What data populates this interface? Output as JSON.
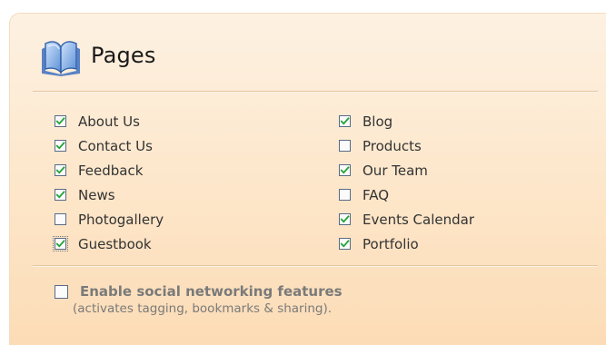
{
  "section": {
    "title": "Pages",
    "icon": "open-book-icon"
  },
  "pages": {
    "left": [
      {
        "label": "About Us",
        "checked": true
      },
      {
        "label": "Contact Us",
        "checked": true
      },
      {
        "label": "Feedback",
        "checked": true
      },
      {
        "label": "News",
        "checked": true
      },
      {
        "label": "Photogallery",
        "checked": false
      },
      {
        "label": "Guestbook",
        "checked": true,
        "focused": true
      }
    ],
    "right": [
      {
        "label": "Blog",
        "checked": true
      },
      {
        "label": "Products",
        "checked": false
      },
      {
        "label": "Our Team",
        "checked": true
      },
      {
        "label": "FAQ",
        "checked": false
      },
      {
        "label": "Events Calendar",
        "checked": true
      },
      {
        "label": "Portfolio",
        "checked": true
      }
    ]
  },
  "social": {
    "label": "Enable social networking features",
    "sublabel": "(activates tagging, bookmarks & sharing).",
    "checked": false
  },
  "colors": {
    "check": "#21a33a",
    "checkbox_border": "#5a6b86",
    "panel_top": "#fdf1e2",
    "panel_bottom": "#fcdcb6",
    "divider": "#e4c6a1"
  }
}
